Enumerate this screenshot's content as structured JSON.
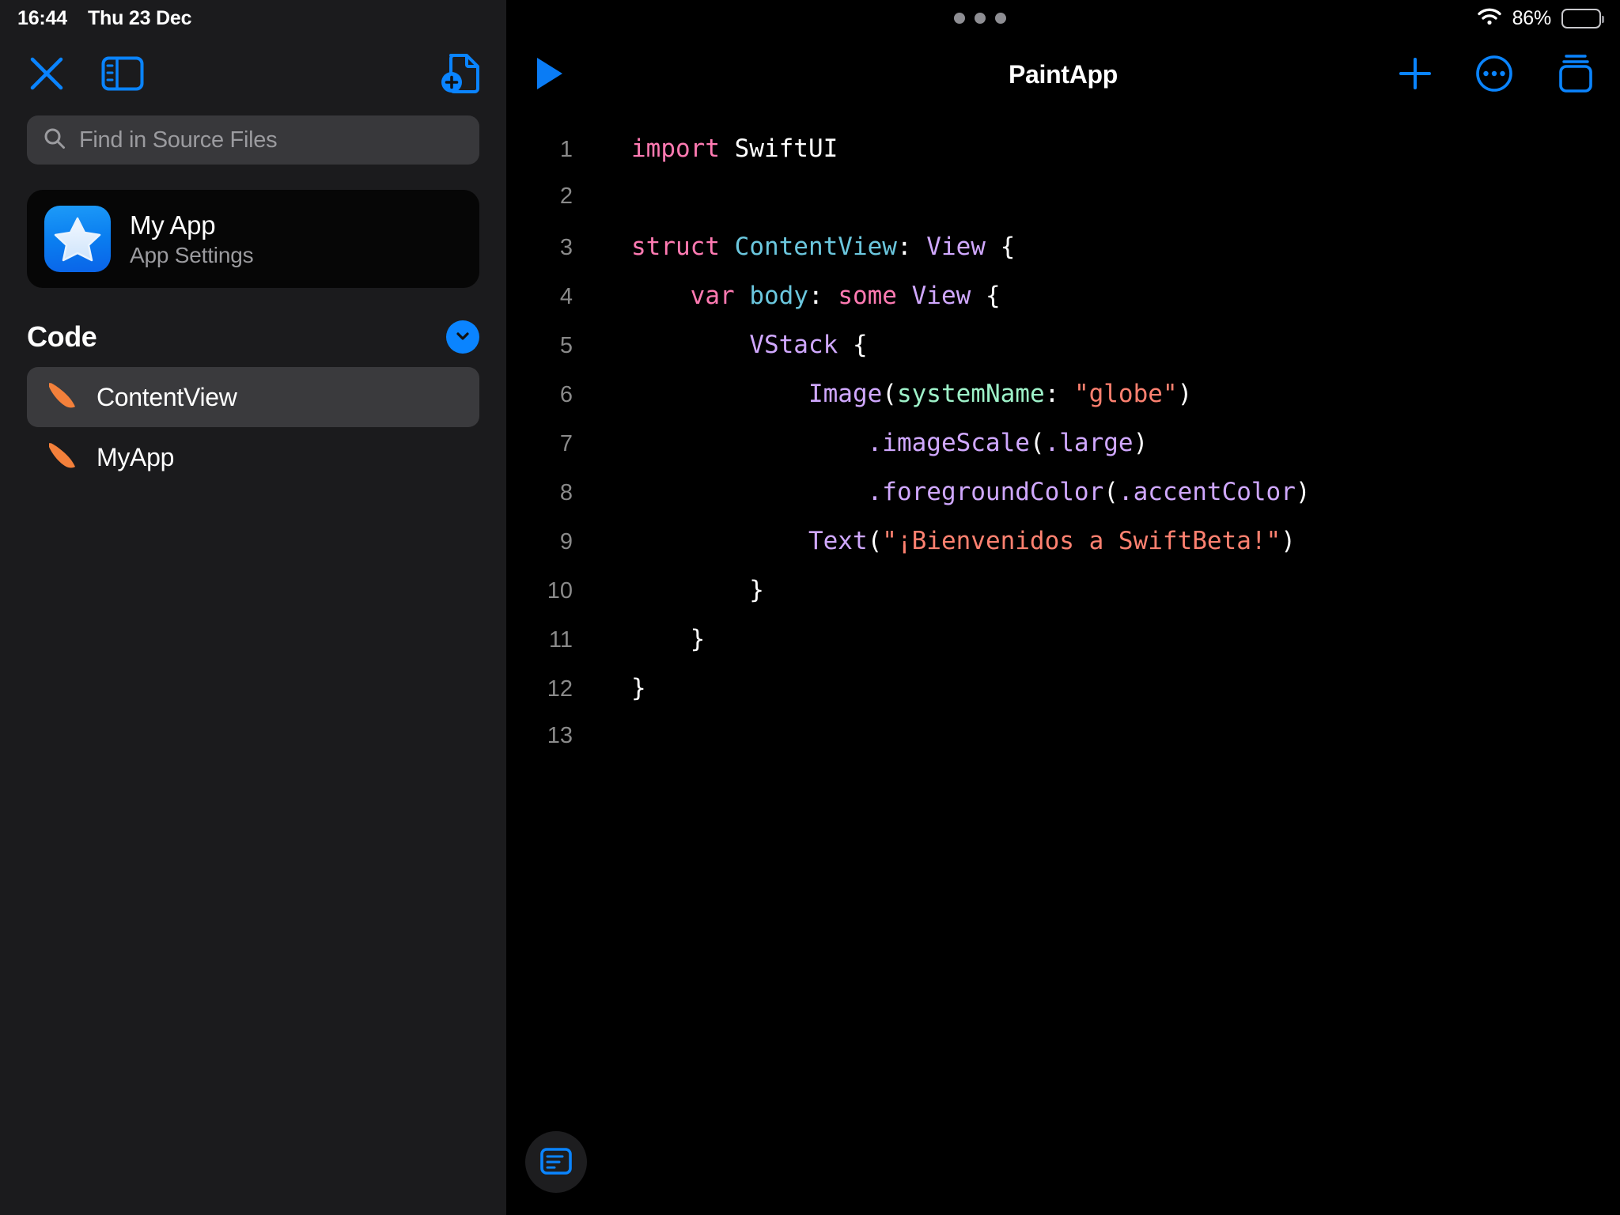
{
  "status_bar": {
    "time": "16:44",
    "date": "Thu 23 Dec",
    "battery_percent": "86%",
    "wifi_icon": "wifi-icon",
    "battery_icon": "battery-icon",
    "grabber_icon": "multitasking-grabber-icon"
  },
  "sidebar": {
    "toolbar": {
      "close_icon": "close-x-icon",
      "sidebar_toggle_icon": "sidebar-toggle-icon",
      "new_file_icon": "new-document-icon"
    },
    "search": {
      "placeholder": "Find in Source Files",
      "value": "",
      "icon": "search-icon"
    },
    "app_card": {
      "title": "My App",
      "subtitle": "App Settings",
      "icon": "star-app-icon"
    },
    "section": {
      "title": "Code",
      "disclosure_icon": "chevron-down-icon"
    },
    "files": [
      {
        "label": "ContentView",
        "icon": "swift-file-icon",
        "selected": true
      },
      {
        "label": "MyApp",
        "icon": "swift-file-icon",
        "selected": false
      }
    ]
  },
  "editor": {
    "title": "PaintApp",
    "run_icon": "play-run-icon",
    "add_icon": "plus-icon",
    "more_icon": "ellipsis-circle-icon",
    "tabs_icon": "stacked-cards-icon",
    "console_icon": "console-panel-icon",
    "language": "swift",
    "lines": [
      {
        "number": "1",
        "tokens": [
          {
            "t": "import",
            "c": "tk-kw"
          },
          {
            "t": " ",
            "c": "tk-plain"
          },
          {
            "t": "SwiftUI",
            "c": "tk-plain"
          }
        ]
      },
      {
        "number": "2",
        "tokens": []
      },
      {
        "number": "3",
        "tokens": [
          {
            "t": "struct",
            "c": "tk-kw"
          },
          {
            "t": " ",
            "c": "tk-plain"
          },
          {
            "t": "ContentView",
            "c": "tk-type"
          },
          {
            "t": ": ",
            "c": "tk-punct"
          },
          {
            "t": "View",
            "c": "tk-proto"
          },
          {
            "t": " {",
            "c": "tk-punct"
          }
        ]
      },
      {
        "number": "4",
        "tokens": [
          {
            "t": "    ",
            "c": "tk-plain"
          },
          {
            "t": "var",
            "c": "tk-kw"
          },
          {
            "t": " ",
            "c": "tk-plain"
          },
          {
            "t": "body",
            "c": "tk-type"
          },
          {
            "t": ": ",
            "c": "tk-punct"
          },
          {
            "t": "some",
            "c": "tk-kw"
          },
          {
            "t": " ",
            "c": "tk-plain"
          },
          {
            "t": "View",
            "c": "tk-proto"
          },
          {
            "t": " {",
            "c": "tk-punct"
          }
        ]
      },
      {
        "number": "5",
        "tokens": [
          {
            "t": "        ",
            "c": "tk-plain"
          },
          {
            "t": "VStack",
            "c": "tk-proto"
          },
          {
            "t": " {",
            "c": "tk-punct"
          }
        ]
      },
      {
        "number": "6",
        "tokens": [
          {
            "t": "            ",
            "c": "tk-plain"
          },
          {
            "t": "Image",
            "c": "tk-proto"
          },
          {
            "t": "(",
            "c": "tk-punct"
          },
          {
            "t": "systemName",
            "c": "tk-param"
          },
          {
            "t": ": ",
            "c": "tk-punct"
          },
          {
            "t": "\"globe\"",
            "c": "tk-str"
          },
          {
            "t": ")",
            "c": "tk-punct"
          }
        ]
      },
      {
        "number": "7",
        "tokens": [
          {
            "t": "                ",
            "c": "tk-plain"
          },
          {
            "t": ".imageScale",
            "c": "tk-call"
          },
          {
            "t": "(",
            "c": "tk-punct"
          },
          {
            "t": ".large",
            "c": "tk-call"
          },
          {
            "t": ")",
            "c": "tk-punct"
          }
        ]
      },
      {
        "number": "8",
        "tokens": [
          {
            "t": "                ",
            "c": "tk-plain"
          },
          {
            "t": ".foregroundColor",
            "c": "tk-call"
          },
          {
            "t": "(",
            "c": "tk-punct"
          },
          {
            "t": ".accentColor",
            "c": "tk-call"
          },
          {
            "t": ")",
            "c": "tk-punct"
          }
        ]
      },
      {
        "number": "9",
        "tokens": [
          {
            "t": "            ",
            "c": "tk-plain"
          },
          {
            "t": "Text",
            "c": "tk-proto"
          },
          {
            "t": "(",
            "c": "tk-punct"
          },
          {
            "t": "\"¡Bienvenidos a SwiftBeta!\"",
            "c": "tk-str"
          },
          {
            "t": ")",
            "c": "tk-punct"
          }
        ]
      },
      {
        "number": "10",
        "tokens": [
          {
            "t": "        }",
            "c": "tk-punct"
          }
        ]
      },
      {
        "number": "11",
        "tokens": [
          {
            "t": "    }",
            "c": "tk-punct"
          }
        ]
      },
      {
        "number": "12",
        "tokens": [
          {
            "t": "}",
            "c": "tk-punct"
          }
        ]
      },
      {
        "number": "13",
        "tokens": []
      }
    ]
  },
  "colors": {
    "accent_blue": "#0a84ff",
    "sidebar_bg": "#1b1b1d",
    "editor_bg": "#000000",
    "selected_row": "#3a3a3d",
    "swift_orange": "#f3803b",
    "keyword_pink": "#ff7ab2",
    "type_cyan": "#6bc7de",
    "proto_purple": "#d0a8ff",
    "param_green": "#9ef2c9",
    "string_salmon": "#ff8170"
  }
}
